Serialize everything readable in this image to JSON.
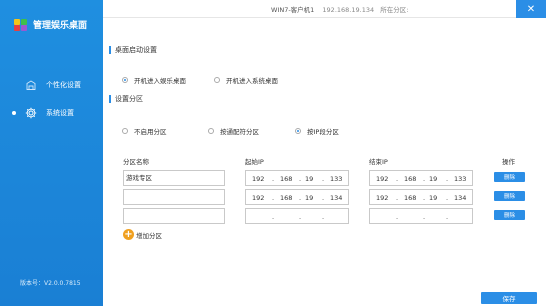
{
  "app": {
    "title": "管理娱乐桌面"
  },
  "topbar": {
    "machine": "WIN7-客户机1",
    "ip": "192.168.19.134",
    "partition_label": "所在分区:",
    "close_symbol": "✕"
  },
  "sidebar": {
    "items": [
      {
        "label": "个性化设置",
        "icon": "personalize-icon",
        "active": false
      },
      {
        "label": "系统设置",
        "icon": "gear-icon",
        "active": true
      }
    ],
    "version": "版本号：V2.0.0.7815"
  },
  "desktop_settings": {
    "title": "桌面启动设置",
    "options": [
      {
        "label": "开机进入娱乐桌面",
        "checked": true
      },
      {
        "label": "开机进入系统桌面",
        "checked": false
      }
    ]
  },
  "partition_settings": {
    "title": "设置分区",
    "options": [
      {
        "label": "不启用分区",
        "checked": false
      },
      {
        "label": "按通配符分区",
        "checked": false
      },
      {
        "label": "按IP段分区",
        "checked": true
      }
    ]
  },
  "table": {
    "headers": {
      "name": "分区名称",
      "start_ip": "起始IP",
      "end_ip": "结束IP",
      "action": "操作"
    },
    "rows": [
      {
        "name": "游戏专区",
        "start": [
          "192",
          "168",
          "19",
          "133"
        ],
        "end": [
          "192",
          "168",
          "19",
          "133"
        ],
        "action": "删除"
      },
      {
        "name": "",
        "start": [
          "192",
          "168",
          "19",
          "134"
        ],
        "end": [
          "192",
          "168",
          "19",
          "134"
        ],
        "action": "删除"
      },
      {
        "name": "",
        "start": [
          "",
          "",
          "",
          ""
        ],
        "end": [
          "",
          "",
          "",
          ""
        ],
        "action": "删除"
      }
    ],
    "dot": "."
  },
  "add_partition": {
    "symbol": "+",
    "label": "增加分区"
  },
  "save_label": "保存",
  "colors": {
    "sidebar": "#1a7fd4",
    "accent": "#2b8ee6",
    "add_button": "#f0a020"
  }
}
